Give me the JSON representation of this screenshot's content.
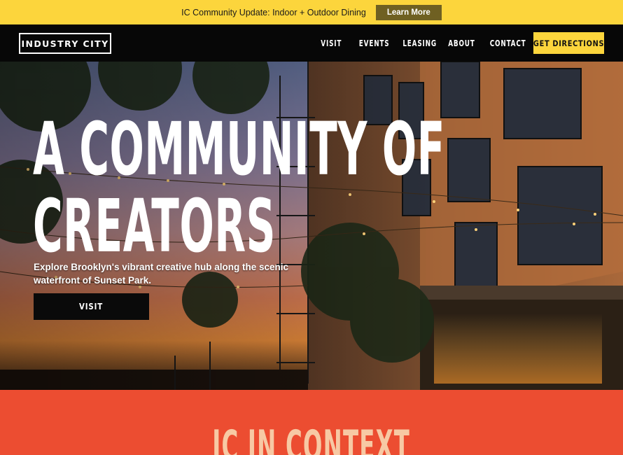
{
  "announcement": {
    "text": "IC Community Update: Indoor + Outdoor Dining",
    "button_label": "Learn More"
  },
  "nav": {
    "logo": "INDUSTRY CITY",
    "links": [
      "VISIT",
      "EVENTS",
      "LEASING",
      "ABOUT",
      "CONTACT"
    ],
    "cta_label": "GET DIRECTIONS"
  },
  "hero": {
    "title_line1": "A COMMUNITY OF",
    "title_line2": "CREATORS",
    "subtitle": "Explore Brooklyn's vibrant creative hub along the scenic waterfront of Sunset Park.",
    "button_label": "VISIT"
  },
  "context": {
    "title": "IC IN CONTEXT"
  },
  "colors": {
    "accent_yellow": "#fcd53c",
    "learn_more_bg": "#6f6022",
    "nav_bg": "#070707",
    "context_bg": "#ec4d31",
    "context_text": "#f7c9a4"
  }
}
